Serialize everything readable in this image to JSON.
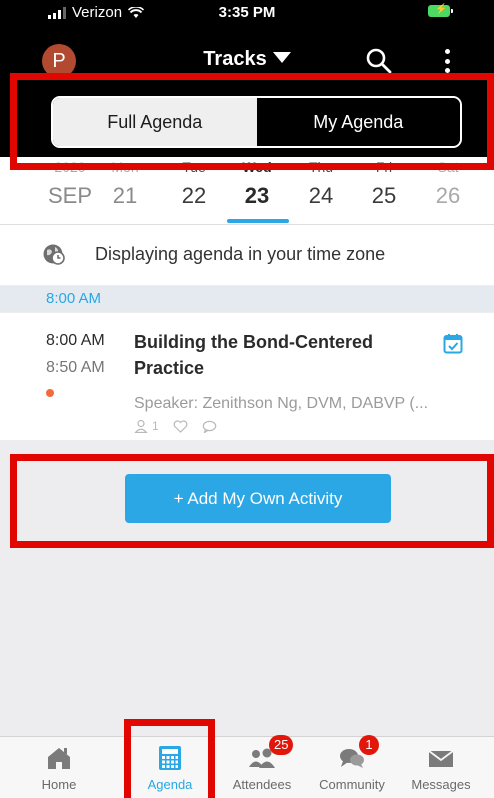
{
  "status_bar": {
    "carrier": "Verizon",
    "time": "3:35 PM",
    "battery_icon": "battery-charging-icon"
  },
  "header": {
    "avatar_letter": "P",
    "title": "Tracks"
  },
  "segments": {
    "full": "Full Agenda",
    "mine": "My Agenda",
    "selected": "mine"
  },
  "dates": [
    {
      "dow": "2020",
      "num": "SEP"
    },
    {
      "dow": "Mon",
      "num": "21"
    },
    {
      "dow": "Tue",
      "num": "22"
    },
    {
      "dow": "Wed",
      "num": "23",
      "selected": true
    },
    {
      "dow": "Thu",
      "num": "24"
    },
    {
      "dow": "Fri",
      "num": "25"
    },
    {
      "dow": "Sat",
      "num": "26"
    }
  ],
  "timezone_notice": "Displaying agenda in your time zone",
  "time_header": "8:00 AM",
  "session": {
    "start": "8:00 AM",
    "end": "8:50 AM",
    "title": "Building the Bond-Centered Practice",
    "speaker": "Speaker: Zenithson Ng, DVM, DABVP (...",
    "attendees": "1"
  },
  "add_button": "+ Add My Own Activity",
  "tabs": [
    {
      "label": "Home",
      "icon": "home-icon"
    },
    {
      "label": "Agenda",
      "icon": "calculator-icon",
      "active": true
    },
    {
      "label": "Attendees",
      "icon": "people-icon",
      "badge": "25"
    },
    {
      "label": "Community",
      "icon": "chat-bubbles-icon",
      "badge": "1"
    },
    {
      "label": "Messages",
      "icon": "envelope-icon"
    }
  ],
  "colors": {
    "accent": "#2aa7e4",
    "highlight": "#e10600",
    "badge": "#e3160b"
  }
}
